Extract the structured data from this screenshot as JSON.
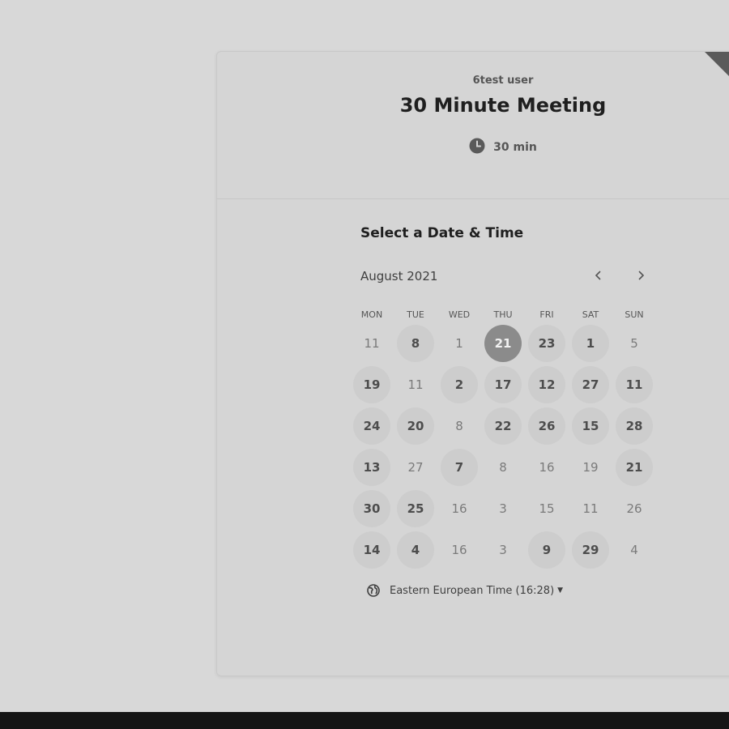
{
  "header": {
    "user_name": "6test user",
    "event_title": "30 Minute Meeting",
    "duration": "30 min",
    "duration_icon": "clock-icon"
  },
  "calendar": {
    "section_title": "Select a Date & Time",
    "month_label": "August 2021",
    "prev_icon": "chevron-left-icon",
    "next_icon": "chevron-right-icon",
    "weekdays": [
      "MON",
      "TUE",
      "WED",
      "THU",
      "FRI",
      "SAT",
      "SUN"
    ],
    "weeks": [
      [
        {
          "label": "11",
          "available": false
        },
        {
          "label": "8",
          "available": true
        },
        {
          "label": "1",
          "available": false
        },
        {
          "label": "21",
          "available": true,
          "selected": true
        },
        {
          "label": "23",
          "available": true
        },
        {
          "label": "1",
          "available": true
        },
        {
          "label": "5",
          "available": false
        }
      ],
      [
        {
          "label": "19",
          "available": true
        },
        {
          "label": "11",
          "available": false
        },
        {
          "label": "2",
          "available": true
        },
        {
          "label": "17",
          "available": true
        },
        {
          "label": "12",
          "available": true
        },
        {
          "label": "27",
          "available": true
        },
        {
          "label": "11",
          "available": true
        }
      ],
      [
        {
          "label": "24",
          "available": true
        },
        {
          "label": "20",
          "available": true
        },
        {
          "label": "8",
          "available": false
        },
        {
          "label": "22",
          "available": true
        },
        {
          "label": "26",
          "available": true
        },
        {
          "label": "15",
          "available": true
        },
        {
          "label": "28",
          "available": true
        }
      ],
      [
        {
          "label": "13",
          "available": true
        },
        {
          "label": "27",
          "available": false
        },
        {
          "label": "7",
          "available": true
        },
        {
          "label": "8",
          "available": false
        },
        {
          "label": "16",
          "available": false
        },
        {
          "label": "19",
          "available": false
        },
        {
          "label": "21",
          "available": true
        }
      ],
      [
        {
          "label": "30",
          "available": true
        },
        {
          "label": "25",
          "available": true
        },
        {
          "label": "16",
          "available": false
        },
        {
          "label": "3",
          "available": false
        },
        {
          "label": "15",
          "available": false
        },
        {
          "label": "11",
          "available": false
        },
        {
          "label": "26",
          "available": false
        }
      ],
      [
        {
          "label": "14",
          "available": true
        },
        {
          "label": "4",
          "available": true
        },
        {
          "label": "16",
          "available": false
        },
        {
          "label": "3",
          "available": false
        },
        {
          "label": "9",
          "available": true
        },
        {
          "label": "29",
          "available": true
        },
        {
          "label": "4",
          "available": false
        }
      ]
    ]
  },
  "timezone": {
    "label": "Eastern European Time (16:28)",
    "icon": "globe-icon"
  }
}
